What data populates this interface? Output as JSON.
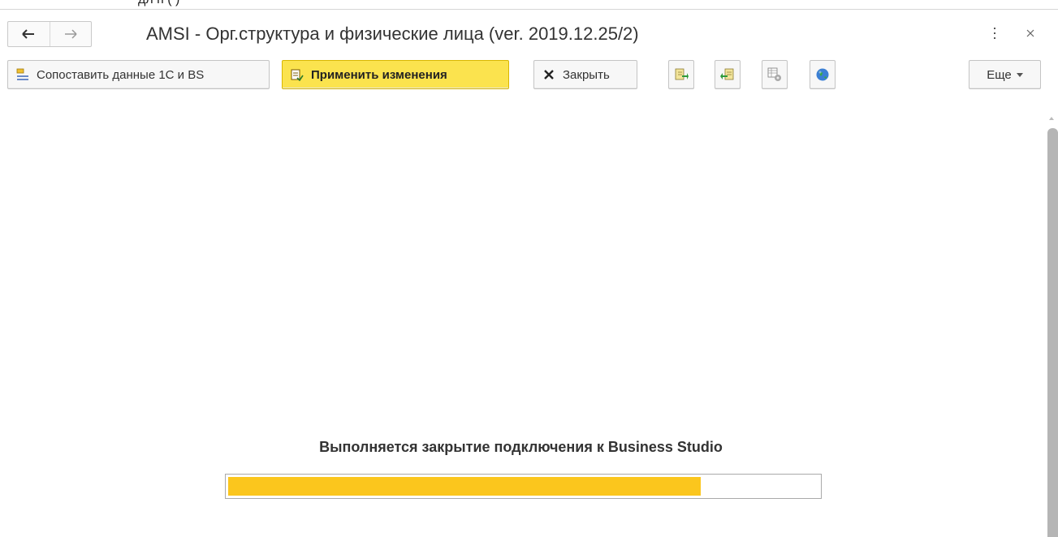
{
  "window": {
    "partial_top_text": "дл                                                  п                                                                    (        )",
    "title": "AMSI - Орг.структура и физические лица (ver. 2019.12.25/2)",
    "nav": {
      "back_icon": "arrow-left-icon",
      "forward_icon": "arrow-right-icon"
    },
    "controls": {
      "menu_icon": "vertical-dots-icon",
      "close_icon": "close-icon"
    }
  },
  "toolbar": {
    "compare_label": "Сопоставить данные 1С и BS",
    "apply_label": "Применить изменения",
    "close_label": "Закрыть",
    "more_label": "Еще",
    "icon_buttons": [
      "export-icon",
      "import-icon",
      "settings-table-icon",
      "globe-icon"
    ]
  },
  "status": {
    "message": "Выполняется закрытие подключения к Business Studio",
    "progress_fraction": 0.8
  },
  "colors": {
    "accent_yellow": "#fbe34e",
    "progress_yellow": "#fbc61d",
    "border_gray": "#c4c4c4",
    "scrollbar_gray": "#b5b5b5"
  }
}
